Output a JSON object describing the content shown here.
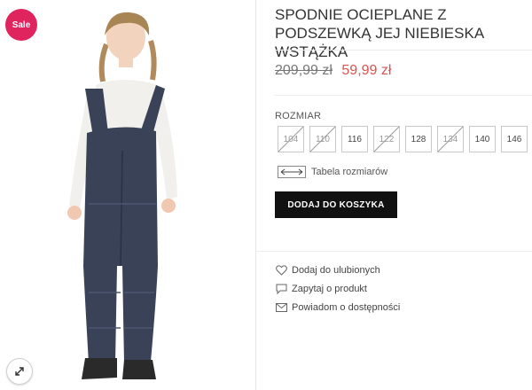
{
  "product": {
    "title": "SPODNIE OCIEPLANE Z PODSZEWKĄ JEJ NIEBIESKA WSTĄŻKA",
    "badge": "Sale",
    "price_old": "209,99 zł",
    "price_new": "59,99 zł"
  },
  "size_selector": {
    "label": "ROZMIAR",
    "sizes": [
      {
        "label": "104",
        "available": false
      },
      {
        "label": "110",
        "available": false
      },
      {
        "label": "116",
        "available": true
      },
      {
        "label": "122",
        "available": false
      },
      {
        "label": "128",
        "available": true
      },
      {
        "label": "134",
        "available": false
      },
      {
        "label": "140",
        "available": true
      },
      {
        "label": "146",
        "available": true
      }
    ],
    "size_table_label": "Tabela rozmiarów"
  },
  "cart": {
    "add_label": "DODAJ DO KOSZYKA"
  },
  "actions": [
    {
      "label": "Dodaj do ulubionych",
      "icon": "heart-icon"
    },
    {
      "label": "Zapytaj o produkt",
      "icon": "speech-bubble-icon"
    },
    {
      "label": "Powiadom o dostępności",
      "icon": "envelope-icon"
    }
  ],
  "colors": {
    "sale": "#e0245e",
    "price_new": "#d9534f",
    "button": "#111111",
    "jumpsuit": "#3a4258",
    "sweater": "#f2f0ec"
  }
}
